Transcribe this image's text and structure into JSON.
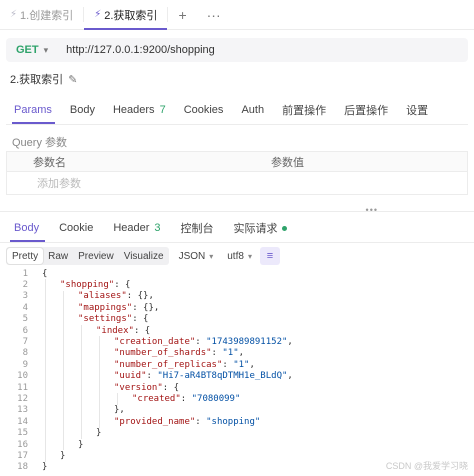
{
  "tabs": [
    {
      "label": "1.创建索引",
      "active": false
    },
    {
      "label": "2.获取索引",
      "active": true
    }
  ],
  "tab_actions": {
    "add": "+",
    "more": "···"
  },
  "request": {
    "method": "GET",
    "url": "http://127.0.0.1:9200/shopping",
    "name": "2.获取索引"
  },
  "param_tabs": [
    {
      "label": "Params",
      "active": true,
      "badge": ""
    },
    {
      "label": "Body",
      "active": false,
      "badge": ""
    },
    {
      "label": "Headers",
      "active": false,
      "badge": "7"
    },
    {
      "label": "Cookies",
      "active": false,
      "badge": ""
    },
    {
      "label": "Auth",
      "active": false,
      "badge": ""
    },
    {
      "label": "前置操作",
      "active": false,
      "badge": ""
    },
    {
      "label": "后置操作",
      "active": false,
      "badge": ""
    },
    {
      "label": "设置",
      "active": false,
      "badge": ""
    }
  ],
  "query": {
    "label": "Query 参数",
    "col_name": "参数名",
    "col_value": "参数值",
    "add_placeholder": "添加参数"
  },
  "response_tabs": [
    {
      "label": "Body",
      "active": true,
      "badge": ""
    },
    {
      "label": "Cookie",
      "active": false,
      "badge": ""
    },
    {
      "label": "Header",
      "active": false,
      "badge": "3"
    },
    {
      "label": "控制台",
      "active": false,
      "badge": ""
    },
    {
      "label": "实际请求",
      "active": false,
      "badge": "",
      "dot": true
    }
  ],
  "view_modes": [
    "Pretty",
    "Raw",
    "Preview",
    "Visualize"
  ],
  "active_view": "Pretty",
  "format": "JSON",
  "encoding": "utf8",
  "code_lines": [
    {
      "n": "1",
      "indent": 0,
      "parts": [
        [
          "p",
          "{"
        ]
      ]
    },
    {
      "n": "2",
      "indent": 1,
      "parts": [
        [
          "k",
          "\"shopping\""
        ],
        [
          "p",
          ": {"
        ]
      ]
    },
    {
      "n": "3",
      "indent": 2,
      "parts": [
        [
          "k",
          "\"aliases\""
        ],
        [
          "p",
          ": {},"
        ]
      ]
    },
    {
      "n": "4",
      "indent": 2,
      "parts": [
        [
          "k",
          "\"mappings\""
        ],
        [
          "p",
          ": {},"
        ]
      ]
    },
    {
      "n": "5",
      "indent": 2,
      "parts": [
        [
          "k",
          "\"settings\""
        ],
        [
          "p",
          ": {"
        ]
      ]
    },
    {
      "n": "6",
      "indent": 3,
      "parts": [
        [
          "k",
          "\"index\""
        ],
        [
          "p",
          ": {"
        ]
      ]
    },
    {
      "n": "7",
      "indent": 4,
      "parts": [
        [
          "k",
          "\"creation_date\""
        ],
        [
          "p",
          ": "
        ],
        [
          "s",
          "\"1743989891152\""
        ],
        [
          "p",
          ","
        ]
      ]
    },
    {
      "n": "8",
      "indent": 4,
      "parts": [
        [
          "k",
          "\"number_of_shards\""
        ],
        [
          "p",
          ": "
        ],
        [
          "s",
          "\"1\""
        ],
        [
          "p",
          ","
        ]
      ]
    },
    {
      "n": "9",
      "indent": 4,
      "parts": [
        [
          "k",
          "\"number_of_replicas\""
        ],
        [
          "p",
          ": "
        ],
        [
          "s",
          "\"1\""
        ],
        [
          "p",
          ","
        ]
      ]
    },
    {
      "n": "10",
      "indent": 4,
      "parts": [
        [
          "k",
          "\"uuid\""
        ],
        [
          "p",
          ": "
        ],
        [
          "s",
          "\"Hi7-aR4BT8qDTMH1e_BLdQ\""
        ],
        [
          "p",
          ","
        ]
      ]
    },
    {
      "n": "11",
      "indent": 4,
      "parts": [
        [
          "k",
          "\"version\""
        ],
        [
          "p",
          ": {"
        ]
      ]
    },
    {
      "n": "12",
      "indent": 5,
      "parts": [
        [
          "k",
          "\"created\""
        ],
        [
          "p",
          ": "
        ],
        [
          "s",
          "\"7080099\""
        ]
      ]
    },
    {
      "n": "13",
      "indent": 4,
      "parts": [
        [
          "p",
          "},"
        ]
      ]
    },
    {
      "n": "14",
      "indent": 4,
      "parts": [
        [
          "k",
          "\"provided_name\""
        ],
        [
          "p",
          ": "
        ],
        [
          "s",
          "\"shopping\""
        ]
      ]
    },
    {
      "n": "15",
      "indent": 3,
      "parts": [
        [
          "p",
          "}"
        ]
      ]
    },
    {
      "n": "16",
      "indent": 2,
      "parts": [
        [
          "p",
          "}"
        ]
      ]
    },
    {
      "n": "17",
      "indent": 1,
      "parts": [
        [
          "p",
          "}"
        ]
      ]
    },
    {
      "n": "18",
      "indent": 0,
      "parts": [
        [
          "p",
          "}"
        ]
      ]
    }
  ],
  "watermark": "CSDN @我爱学习晓",
  "colors": {
    "accent": "#6a5acd",
    "method_get": "#2fa36b",
    "json_key": "#a31515",
    "json_string": "#0451a5"
  },
  "icons": {
    "tab": "lightning-icon",
    "edit": "pencil-icon",
    "wrap": "wrap-lines-icon"
  }
}
